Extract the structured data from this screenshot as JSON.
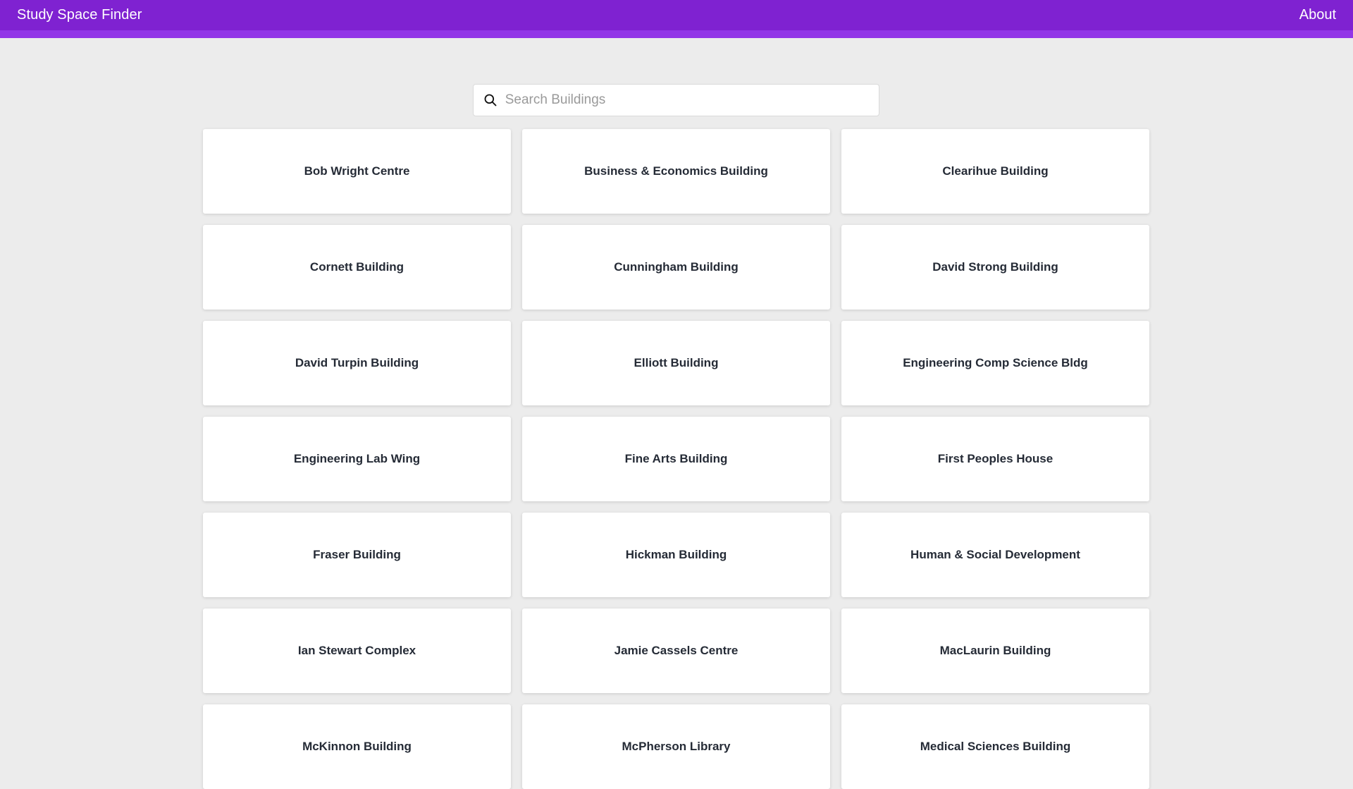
{
  "header": {
    "title": "Study Space Finder",
    "about_label": "About",
    "brand_color": "#7f22d1",
    "brand_stripe_color": "#9235e7"
  },
  "search": {
    "placeholder": "Search Buildings",
    "value": "",
    "icon": "search-icon"
  },
  "buildings": [
    "Bob Wright Centre",
    "Business & Economics Building",
    "Clearihue Building",
    "Cornett Building",
    "Cunningham Building",
    "David Strong Building",
    "David Turpin Building",
    "Elliott Building",
    "Engineering Comp Science Bldg",
    "Engineering Lab Wing",
    "Fine Arts Building",
    "First Peoples House",
    "Fraser Building",
    "Hickman Building",
    "Human & Social Development",
    "Ian Stewart Complex",
    "Jamie Cassels Centre",
    "MacLaurin Building",
    "McKinnon Building",
    "McPherson Library",
    "Medical Sciences Building"
  ]
}
